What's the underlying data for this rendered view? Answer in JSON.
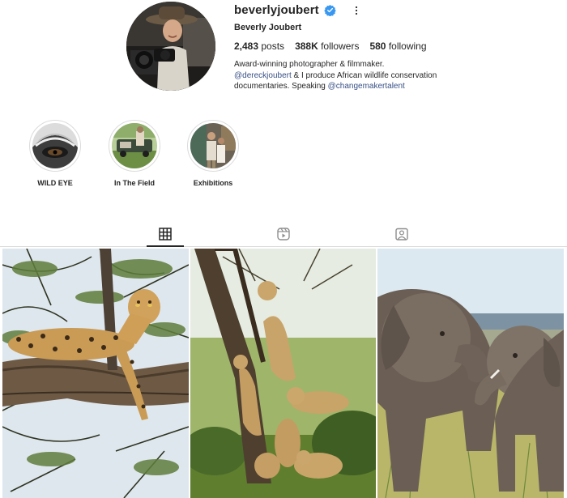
{
  "profile": {
    "username": "beverlyjoubert",
    "full_name": "Beverly Joubert",
    "verified": true,
    "stats": {
      "posts_count": "2,483",
      "posts_label": "posts",
      "followers_count": "388K",
      "followers_label": "followers",
      "following_count": "580",
      "following_label": "following"
    },
    "bio": {
      "line1": "Award-winning photographer & filmmaker.",
      "line2_mention": "@dereckjoubert",
      "line2_text": " & I produce African wildlife conservation",
      "line3_text": "documentaries. Speaking ",
      "line3_mention": "@changemakertalent"
    }
  },
  "highlights": [
    {
      "label": "WILD EYE"
    },
    {
      "label": "In The Field"
    },
    {
      "label": "Exhibitions"
    }
  ],
  "tabs": [
    {
      "icon": "grid-icon",
      "active": true
    },
    {
      "icon": "reels-icon",
      "active": false
    },
    {
      "icon": "tagged-icon",
      "active": false
    }
  ],
  "posts": [
    {
      "subject": "leopard-in-tree"
    },
    {
      "subject": "lion-cubs-climbing-tree"
    },
    {
      "subject": "young-elephants-playing"
    }
  ],
  "colors": {
    "verified_blue": "#3897f0",
    "mention_blue": "#385185",
    "border": "#dbdbdb",
    "text": "#262626"
  }
}
